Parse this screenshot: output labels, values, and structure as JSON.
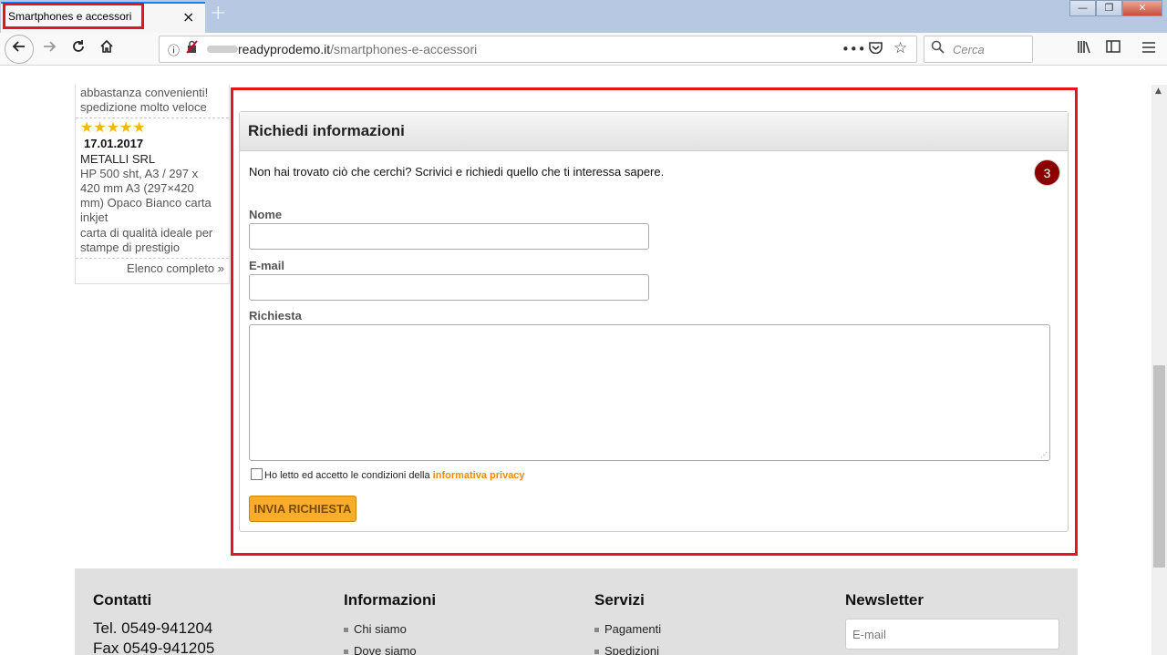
{
  "browser": {
    "tab_title": "Smartphones e accessori",
    "tab_close_icon": "×",
    "new_tab_icon": "+",
    "url_domain": "readyprodemo.it",
    "url_path": "/smartphones-e-accessori",
    "search_placeholder": "Cerca",
    "window_controls": {
      "minimize": "—",
      "restore": "❐",
      "close": "✕"
    },
    "nav_icons": [
      "back-icon",
      "forward-icon",
      "reload-icon",
      "home-icon"
    ],
    "url_icons": {
      "info": "ⓘ",
      "page_actions": "•••",
      "pocket": "◙",
      "bookmark": "☆"
    }
  },
  "sidebar": {
    "review_prev_lines": [
      "abbastanza convenienti!",
      "spedizione molto veloce"
    ],
    "review": {
      "stars": "★★★★★",
      "date": "17.01.2017",
      "company": "METALLI SRL",
      "product": [
        "HP 500 sht, A3 / 297 x",
        "420 mm A3 (297×420",
        "mm) Opaco Bianco carta",
        "inkjet"
      ],
      "comment": [
        "carta di qualità ideale per",
        "stampe di prestigio"
      ]
    },
    "more_link": "Elenco completo »"
  },
  "form": {
    "title": "Richiedi informazioni",
    "intro": "Non hai trovato ciò che cerchi? Scrivici e richiedi quello che ti interessa sapere.",
    "badge": "3",
    "name_label": "Nome",
    "email_label": "E-mail",
    "request_label": "Richiesta",
    "privacy_text": "Ho letto ed accetto le condizioni della ",
    "privacy_link": "informativa privacy",
    "submit_label": "INVIA RICHIESTA"
  },
  "footer": {
    "contacts": {
      "title": "Contatti",
      "lines": [
        "Tel. 0549-941204",
        "Fax 0549-941205"
      ]
    },
    "info": {
      "title": "Informazioni",
      "links": [
        "Chi siamo",
        "Dove siamo"
      ]
    },
    "services": {
      "title": "Servizi",
      "links": [
        "Pagamenti",
        "Spedizioni"
      ]
    },
    "newsletter": {
      "title": "Newsletter",
      "placeholder": "E-mail"
    }
  },
  "colors": {
    "annotation": "#e8141b",
    "accent_orange": "#f9ad2a",
    "badge": "#8b0000"
  }
}
